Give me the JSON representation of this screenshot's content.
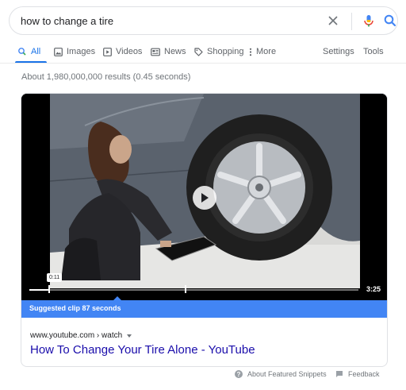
{
  "search": {
    "query": "how to change a tire"
  },
  "tabs": [
    {
      "label": "All",
      "icon": "search-icon",
      "active": true
    },
    {
      "label": "Images",
      "icon": "image-icon"
    },
    {
      "label": "Videos",
      "icon": "video-play-icon"
    },
    {
      "label": "News",
      "icon": "newspaper-icon"
    },
    {
      "label": "Shopping",
      "icon": "tag-icon"
    },
    {
      "label": "More",
      "icon": "more-vert-icon"
    }
  ],
  "tools": {
    "settings": "Settings",
    "tools": "Tools"
  },
  "stats": "About 1,980,000,000 results (0.45 seconds)",
  "snippet": {
    "video": {
      "clip_start": "0:11",
      "duration": "3:25",
      "suggested_clip": "Suggested clip 87 seconds"
    },
    "cite": "www.youtube.com › watch",
    "title": "How To Change Your Tire Alone - YouTube"
  },
  "footer": {
    "about": "About Featured Snippets",
    "feedback": "Feedback"
  },
  "colors": {
    "accent": "#1a73e8",
    "link": "#1a0dab",
    "suggested_bar": "#4285f4"
  }
}
